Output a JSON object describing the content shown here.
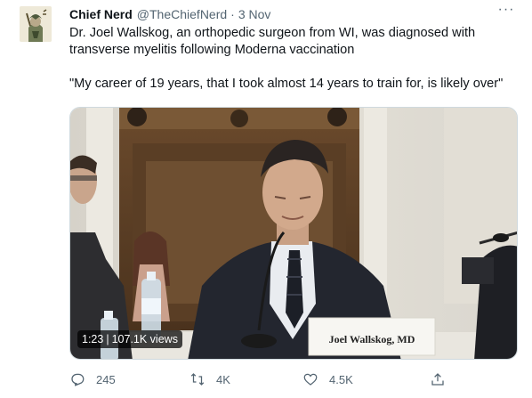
{
  "tweet": {
    "author_name": "Chief Nerd",
    "handle": "@TheChiefNerd",
    "separator": "·",
    "date": "3 Nov",
    "more_glyph": "···",
    "text_line1": "Dr. Joel Wallskog, an orthopedic surgeon from WI, was diagnosed with",
    "text_line2": "transverse myelitis following Moderna vaccination",
    "quote": "\"My career of 19 years, that I took almost 14 years to train for, is likely over\""
  },
  "media": {
    "duration": "1:23",
    "divider": "|",
    "views": "107.1K views",
    "nameplate": "Joel Wallskog, MD"
  },
  "actions": {
    "replies": "245",
    "retweets": "4K",
    "likes": "4.5K",
    "icons": [
      "reply-icon",
      "retweet-icon",
      "like-icon",
      "share-icon"
    ]
  },
  "colors": {
    "text": "#0f1419",
    "secondary": "#536471",
    "border": "#cfd9de"
  }
}
